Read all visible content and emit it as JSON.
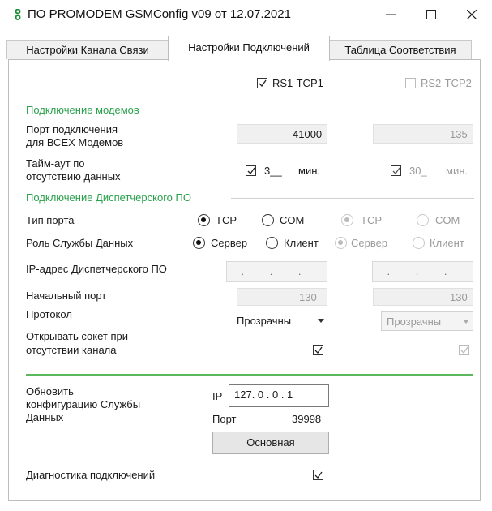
{
  "window": {
    "title": "ПО PROMODEM GSMConfig v09 от 12.07.2021",
    "minimize": "—",
    "close": "✕"
  },
  "tabs": [
    {
      "label": "Настройки Канала Связи",
      "active": false
    },
    {
      "label": "Настройки Подключений",
      "active": true
    },
    {
      "label": "Таблица Соответствия",
      "active": false
    }
  ],
  "columns": {
    "col1": {
      "label": "RS1-TCP1",
      "checked": true
    },
    "col2": {
      "label": "RS2-TCP2",
      "checked": false
    }
  },
  "sections": {
    "modems": "Подключение модемов",
    "dispatcher": "Подключение Диспетчерского ПО"
  },
  "modem_port": {
    "label_line1": "Порт подключения",
    "label_line2": "для ВСЕХ Модемов",
    "col1": "41000",
    "col2": "135"
  },
  "timeout": {
    "label_line1": "Тайм-аут по",
    "label_line2": "отсутствию данных",
    "col1_value": "3__",
    "col1_unit": "мин.",
    "col2_value": "30_",
    "col2_unit": "мин."
  },
  "port_type": {
    "label": "Тип порта",
    "options": [
      "TCP",
      "COM"
    ],
    "col1_selected": "TCP",
    "col2_selected": "TCP"
  },
  "data_role": {
    "label": "Роль Службы Данных",
    "options": [
      "Сервер",
      "Клиент"
    ],
    "col1_selected": "Сервер",
    "col2_selected": "Сервер"
  },
  "dispatcher_ip": {
    "label": "IP-адрес Диспетчерского ПО",
    "col1": ". . .",
    "col2": ". . ."
  },
  "start_port": {
    "label": "Начальный порт",
    "col1": "130",
    "col2": "130"
  },
  "protocol": {
    "label": "Протокол",
    "col1": "Прозрачны",
    "col2": "Прозрачны"
  },
  "open_socket": {
    "label_line1": "Открывать сокет при",
    "label_line2": "отсутствии канала",
    "col1_checked": true,
    "col2_checked": true
  },
  "update_config": {
    "label_line1": "Обновить",
    "label_line2": "конфигурацию Службы",
    "label_line3": "Данных",
    "ip_label": "IP",
    "ip_value": "127. 0 . 0 . 1",
    "port_label": "Порт",
    "port_value": "39998",
    "button": "Основная"
  },
  "diagnostics": {
    "label": "Диагностика подключений",
    "checked": true
  },
  "colors": {
    "section_green": "#2aa14b",
    "divider_green": "#5cb85c",
    "disabled_grey": "#9a9a9a"
  }
}
